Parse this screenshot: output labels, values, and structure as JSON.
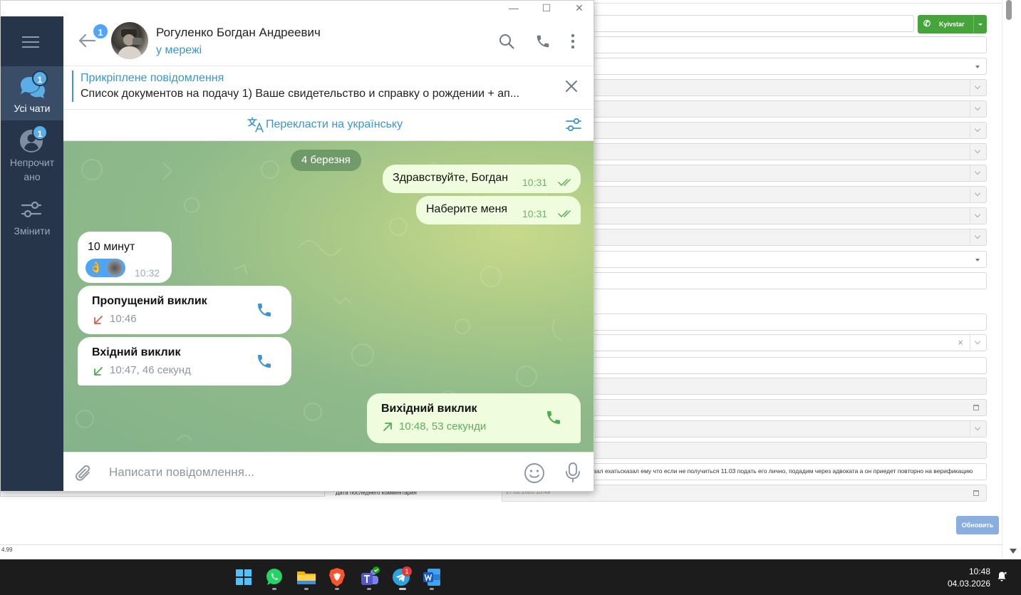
{
  "window": {
    "minimize_glyph": "—",
    "maximize_glyph": "☐",
    "close_glyph": "✕"
  },
  "sidebar": {
    "items": [
      {
        "label": "Усі чати",
        "badge": "1",
        "icon": "chats-icon",
        "active": true
      },
      {
        "label_lines": [
          "Непрочит",
          "ано"
        ],
        "badge": "1",
        "icon": "user-icon"
      },
      {
        "label": "Змінити",
        "icon": "filter-icon"
      }
    ]
  },
  "header": {
    "back_badge": "1",
    "name": "Рогуленко Богдан Андреевич",
    "status": "у мережі"
  },
  "pinned": {
    "title": "Прикріплене повідомлення",
    "text": "Список документов на подачу  1) Ваше свидетельство и справку о рождении + ап..."
  },
  "translate": {
    "label": "Перекласти на українську"
  },
  "chat": {
    "date": "4 березня",
    "messages": [
      {
        "dir": "out",
        "text": "Здравствуйте, Богдан",
        "time": "10:31",
        "read": true
      },
      {
        "dir": "out",
        "text": "Наберите меня",
        "time": "10:31",
        "read": true
      },
      {
        "dir": "in",
        "text": "10 минут",
        "time": "10:32",
        "reaction": "👌"
      },
      {
        "dir": "in",
        "type": "call",
        "title": "Пропущений виклик",
        "sub": "10:46",
        "call_state": "missed"
      },
      {
        "dir": "in",
        "type": "call",
        "title": "Вхідний виклик",
        "sub": "10:47, 46 секунд",
        "call_state": "incoming"
      },
      {
        "dir": "out",
        "type": "call",
        "title": "Вихідний виклик",
        "sub": "10:48, 53 секунди",
        "call_state": "outgoing"
      }
    ]
  },
  "composer": {
    "placeholder": "Написати повідомлення..."
  },
  "background_app": {
    "call_button": "Kyivstar",
    "comment_text": "зал ехатьсказал ему что если не получиться 11.03 подать его лично, подадим через адвоката а он приедет повторно на верификацию",
    "last_comment_label": "Дата последнего комментария",
    "last_comment_date": "27.02.2026 10:49",
    "update_button": "Обновить",
    "version": "4.99"
  },
  "taskbar": {
    "apps": [
      "windows-start-icon",
      "whatsapp-icon",
      "file-explorer-icon",
      "brave-icon",
      "teams-icon",
      "telegram-icon",
      "word-icon"
    ],
    "telegram_badge": "1",
    "time": "10:48",
    "date": "04.03.2026"
  },
  "colors": {
    "accent": "#3a95d8",
    "sidebar": "#26354a",
    "outgoing_bubble": "#effdde",
    "kyivstar_green": "#45a53a"
  }
}
